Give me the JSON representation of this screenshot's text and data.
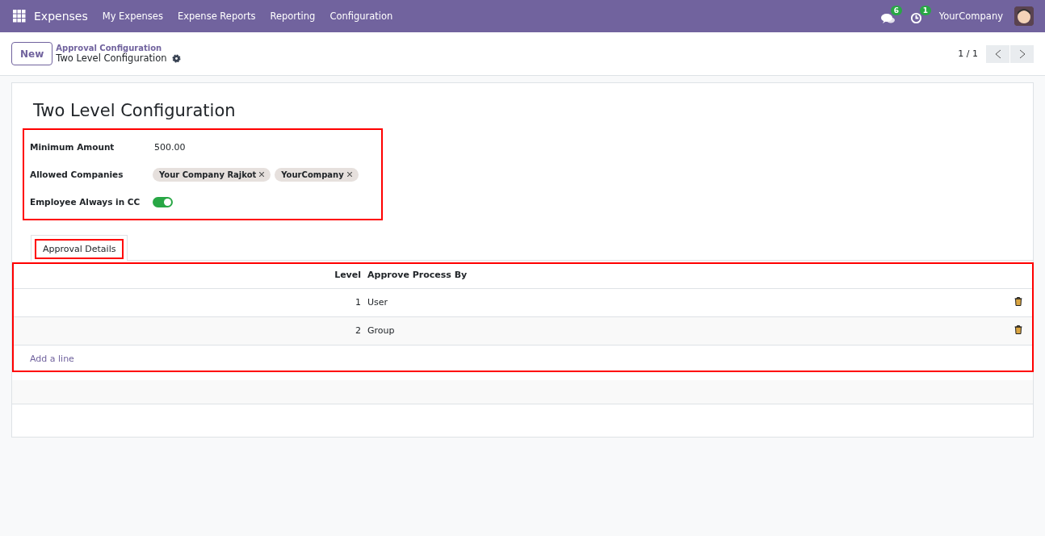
{
  "navbar": {
    "app": "Expenses",
    "menu": [
      "My Expenses",
      "Expense Reports",
      "Reporting",
      "Configuration"
    ],
    "messages_count": "6",
    "activities_count": "1",
    "company": "YourCompany"
  },
  "control_panel": {
    "new_button": "New",
    "breadcrumb": "Approval Configuration",
    "record": "Two Level Configuration",
    "pager": "1 / 1"
  },
  "form": {
    "title": "Two Level Configuration",
    "highlighted": true,
    "fields": [
      {
        "kind": "text",
        "label": "Minimum Amount",
        "value": "500.00"
      },
      {
        "kind": "tags",
        "label": "Allowed Companies",
        "tags": [
          "Your Company Rajkot",
          "YourCompany"
        ]
      },
      {
        "kind": "toggle",
        "label": "Employee Always in CC",
        "on": true
      }
    ],
    "tabs": [
      {
        "label": "Approval Details",
        "selected": true,
        "highlighted": true
      }
    ],
    "table": {
      "highlighted": true,
      "columns": [
        "Level",
        "Approve Process By"
      ],
      "rows": [
        {
          "level": "1",
          "approve_by": "User"
        },
        {
          "level": "2",
          "approve_by": "Group"
        }
      ],
      "add_line": "Add a line"
    }
  }
}
